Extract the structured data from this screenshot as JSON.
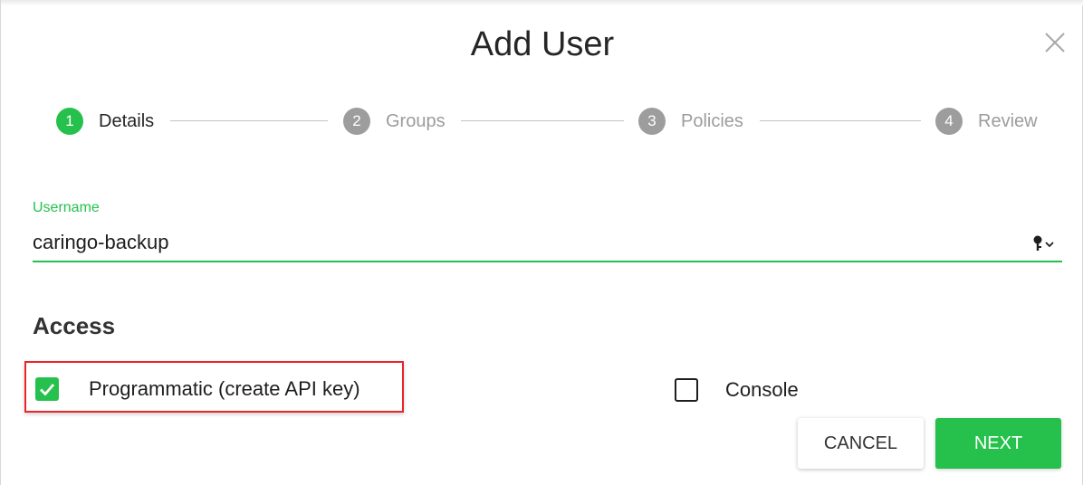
{
  "dialog": {
    "title": "Add User",
    "close_icon": "close-icon"
  },
  "stepper": {
    "steps": [
      {
        "number": "1",
        "label": "Details",
        "state": "active"
      },
      {
        "number": "2",
        "label": "Groups",
        "state": "pending"
      },
      {
        "number": "3",
        "label": "Policies",
        "state": "pending"
      },
      {
        "number": "4",
        "label": "Review",
        "state": "pending"
      }
    ]
  },
  "username": {
    "label": "Username",
    "value": "caringo-backup",
    "key_icon": "key-dropdown-icon"
  },
  "access": {
    "title": "Access",
    "options": [
      {
        "label": "Programmatic (create API key)",
        "checked": true
      },
      {
        "label": "Console",
        "checked": false
      }
    ]
  },
  "actions": {
    "cancel_label": "CANCEL",
    "next_label": "NEXT"
  },
  "colors": {
    "accent": "#25c14c",
    "highlight": "#e8262a",
    "pending_step": "#9d9d9d",
    "text": "#1e1e1e"
  }
}
